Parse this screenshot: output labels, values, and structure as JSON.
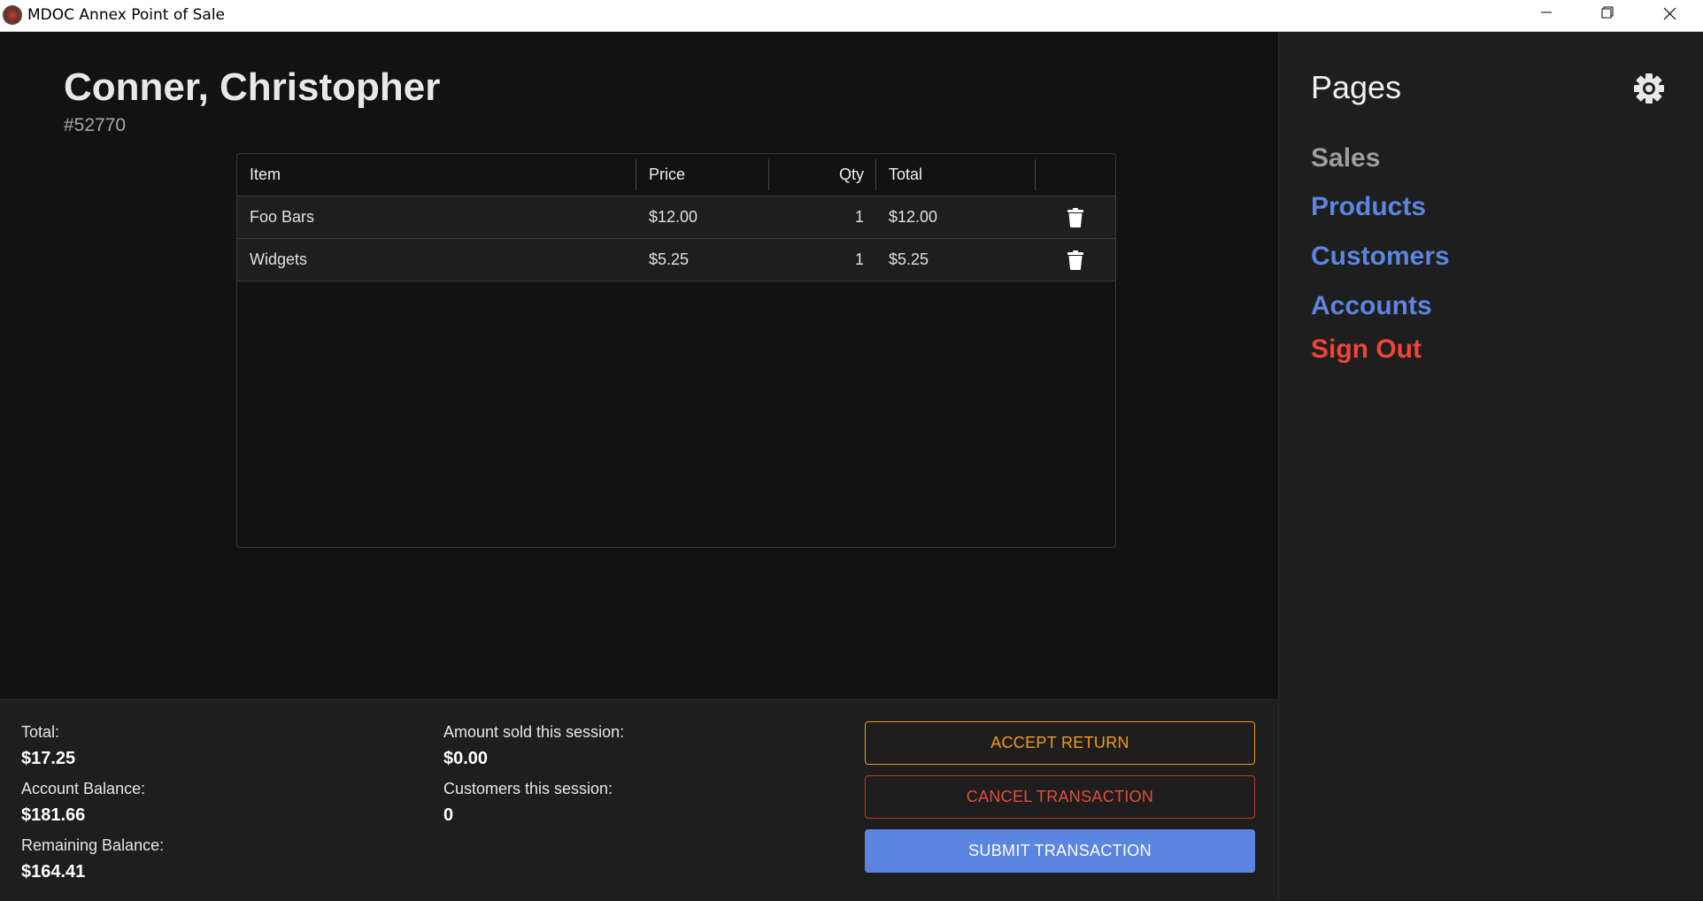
{
  "window": {
    "title": "MDOC Annex Point of Sale",
    "icons": [
      "app-logo-icon",
      "minimize-icon",
      "maximize-icon",
      "close-icon"
    ]
  },
  "customer": {
    "name": "Conner, Christopher",
    "id": "#52770"
  },
  "cart": {
    "columns": [
      "Item",
      "Price",
      "Qty",
      "Total",
      ""
    ],
    "rows": [
      {
        "item": "Foo Bars",
        "price": "$12.00",
        "qty": "1",
        "total": "$12.00",
        "action_icon": "trash-icon"
      },
      {
        "item": "Widgets",
        "price": "$5.25",
        "qty": "1",
        "total": "$5.25",
        "action_icon": "trash-icon"
      }
    ]
  },
  "summary": {
    "total_label": "Total:",
    "total_value": "$17.25",
    "account_balance_label": "Account Balance:",
    "account_balance_value": "$181.66",
    "remaining_balance_label": "Remaining Balance:",
    "remaining_balance_value": "$164.41",
    "amount_sold_label": "Amount sold this session:",
    "amount_sold_value": "$0.00",
    "customers_label": "Customers this session:",
    "customers_value": "0"
  },
  "actions": {
    "accept_return": "ACCEPT RETURN",
    "cancel_transaction": "CANCEL TRANSACTION",
    "submit_transaction": "SUBMIT TRANSACTION"
  },
  "sidebar": {
    "title": "Pages",
    "settings_icon": "gear-icon",
    "items": [
      {
        "label": "Sales",
        "state": "active"
      },
      {
        "label": "Products",
        "state": "link"
      },
      {
        "label": "Customers",
        "state": "link"
      },
      {
        "label": "Accounts",
        "state": "link"
      },
      {
        "label": "Sign Out",
        "state": "danger"
      }
    ]
  },
  "colors": {
    "background": "#121212",
    "panel": "#1e1e1e",
    "accent": "#5b85e0",
    "warning": "#f39c12",
    "danger": "#e74c3c",
    "nav_active": "#9e9e9e"
  }
}
